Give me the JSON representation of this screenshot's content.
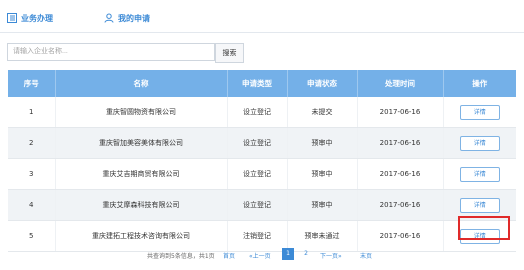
{
  "tabs": [
    {
      "label": "业务办理",
      "icon": "list-icon"
    },
    {
      "label": "我的申请",
      "icon": "user-icon"
    }
  ],
  "search": {
    "placeholder": "请输入企业名称...",
    "button_label": "搜索"
  },
  "table": {
    "headers": [
      "序号",
      "名称",
      "申请类型",
      "申请状态",
      "处理时间",
      "操作"
    ],
    "rows": [
      {
        "no": "1",
        "name": "重庆智圆物资有限公司",
        "type": "设立登记",
        "status": "未提交",
        "date": "2017-06-16",
        "action": "详情"
      },
      {
        "no": "2",
        "name": "重庆智加美容美体有限公司",
        "type": "设立登记",
        "status": "预审中",
        "date": "2017-06-16",
        "action": "详情"
      },
      {
        "no": "3",
        "name": "重庆艾吉期商贸有限公司",
        "type": "设立登记",
        "status": "预审中",
        "date": "2017-06-16",
        "action": "详情"
      },
      {
        "no": "4",
        "name": "重庆艾摩森科技有限公司",
        "type": "设立登记",
        "status": "预审中",
        "date": "2017-06-16",
        "action": "详情"
      },
      {
        "no": "5",
        "name": "重庆建拓工程技术咨询有限公司",
        "type": "注销登记",
        "status": "预审未通过",
        "date": "2017-06-16",
        "action": "详情"
      }
    ]
  },
  "pager": {
    "info": "共查询到5条信息，共1页",
    "first": "首页",
    "prev": "«上一页",
    "page1": "1",
    "page2": "2",
    "next": "下一页»",
    "last": "末页"
  },
  "colors": {
    "accent": "#3c8ad6",
    "header": "#74b0e8",
    "highlight": "#e02a2a"
  }
}
